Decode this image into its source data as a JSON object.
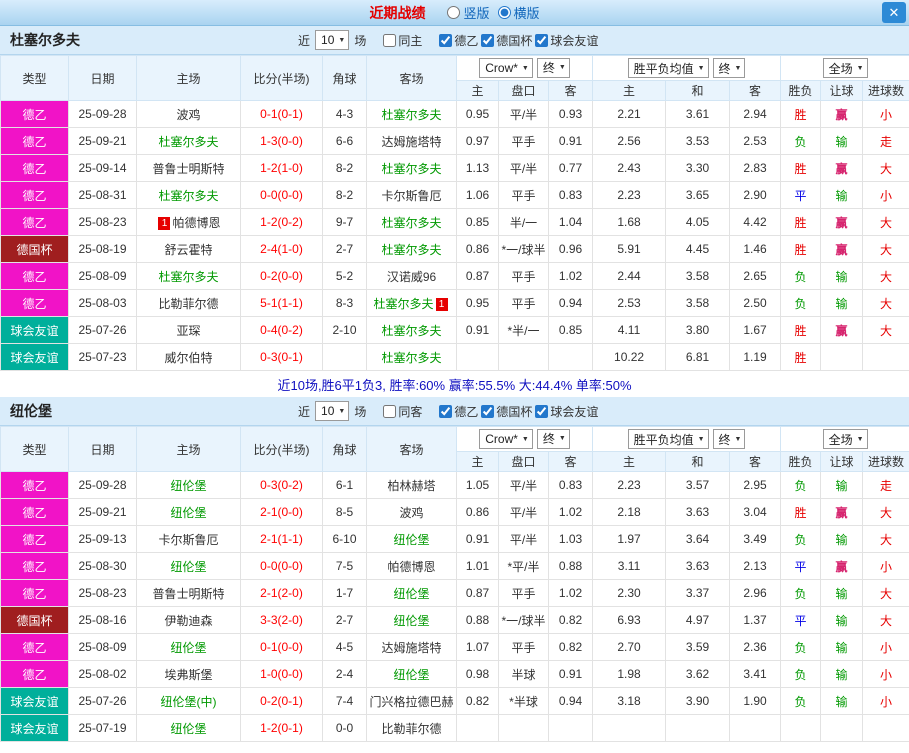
{
  "titlebar": {
    "title": "近期战绩",
    "layout_options": [
      "竖版",
      "横版"
    ],
    "selected_layout": "横版",
    "close_icon": "✕"
  },
  "columns": {
    "type": "类型",
    "date": "日期",
    "home": "主场",
    "score": "比分(半场)",
    "corner": "角球",
    "away": "客场",
    "ah_home": "主",
    "ah_line": "盘口",
    "ah_away": "客",
    "eu_home": "主",
    "eu_draw": "和",
    "eu_away": "客",
    "result": "胜负",
    "let_ball": "让球",
    "goals": "进球数"
  },
  "dropdowns": {
    "company": "Crow*",
    "final1": "终",
    "avg": "胜平负均值",
    "final2": "终",
    "scope": "全场"
  },
  "colors": {
    "league_de2": "#f113c7",
    "league_cup": "#a01e1f",
    "league_friendly": "#00af9b",
    "win": "#e60000",
    "draw": "#0000e6",
    "loss": "#009900",
    "focus_team": "#009900",
    "score": "#ff0000",
    "handicap_win": "#d6246e"
  },
  "sections": [
    {
      "team": "杜塞尔多夫",
      "filters": {
        "near": "近",
        "count": "10",
        "games": "场",
        "same": {
          "label": "同主",
          "checked": false
        },
        "leagues": [
          {
            "label": "德乙",
            "checked": true
          },
          {
            "label": "德国杯",
            "checked": true
          },
          {
            "label": "球会友谊",
            "checked": true
          }
        ]
      },
      "rows": [
        {
          "league": "德乙",
          "league_class": "de2",
          "date": "25-09-28",
          "home": "波鸡",
          "home_focus": false,
          "home_badge": "",
          "score": "0-1(0-1)",
          "corner": "4-3",
          "away": "杜塞尔多夫",
          "away_focus": true,
          "away_badge": "",
          "asian_odds": [
            "0.95",
            "平/半",
            "0.93"
          ],
          "euro_odds": [
            "2.21",
            "3.61",
            "2.94"
          ],
          "result": "胜",
          "result_class": "win",
          "handicap_result": "赢",
          "handicap_class": "win",
          "goals": "小"
        },
        {
          "league": "德乙",
          "league_class": "de2",
          "date": "25-09-21",
          "home": "杜塞尔多夫",
          "home_focus": true,
          "home_badge": "",
          "score": "1-3(0-0)",
          "corner": "6-6",
          "away": "达姆施塔特",
          "away_focus": false,
          "away_badge": "",
          "asian_odds": [
            "0.97",
            "平手",
            "0.91"
          ],
          "euro_odds": [
            "2.56",
            "3.53",
            "2.53"
          ],
          "result": "负",
          "result_class": "loss",
          "handicap_result": "输",
          "handicap_class": "loss",
          "goals": "走"
        },
        {
          "league": "德乙",
          "league_class": "de2",
          "date": "25-09-14",
          "home": "普鲁士明斯特",
          "home_focus": false,
          "home_badge": "",
          "score": "1-2(1-0)",
          "corner": "8-2",
          "away": "杜塞尔多夫",
          "away_focus": true,
          "away_badge": "",
          "asian_odds": [
            "1.13",
            "平/半",
            "0.77"
          ],
          "euro_odds": [
            "2.43",
            "3.30",
            "2.83"
          ],
          "result": "胜",
          "result_class": "win",
          "handicap_result": "赢",
          "handicap_class": "win",
          "goals": "大"
        },
        {
          "league": "德乙",
          "league_class": "de2",
          "date": "25-08-31",
          "home": "杜塞尔多夫",
          "home_focus": true,
          "home_badge": "",
          "score": "0-0(0-0)",
          "corner": "8-2",
          "away": "卡尔斯鲁厄",
          "away_focus": false,
          "away_badge": "",
          "asian_odds": [
            "1.06",
            "平手",
            "0.83"
          ],
          "euro_odds": [
            "2.23",
            "3.65",
            "2.90"
          ],
          "result": "平",
          "result_class": "draw",
          "handicap_result": "输",
          "handicap_class": "loss",
          "goals": "小"
        },
        {
          "league": "德乙",
          "league_class": "de2",
          "date": "25-08-23",
          "home": "帕德博恩",
          "home_focus": false,
          "home_badge": "1",
          "score": "1-2(0-2)",
          "corner": "9-7",
          "away": "杜塞尔多夫",
          "away_focus": true,
          "away_badge": "",
          "asian_odds": [
            "0.85",
            "半/一",
            "1.04"
          ],
          "euro_odds": [
            "1.68",
            "4.05",
            "4.42"
          ],
          "result": "胜",
          "result_class": "win",
          "handicap_result": "赢",
          "handicap_class": "win",
          "goals": "大"
        },
        {
          "league": "德国杯",
          "league_class": "cup",
          "date": "25-08-19",
          "home": "舒云霍特",
          "home_focus": false,
          "home_badge": "",
          "score": "2-4(1-0)",
          "corner": "2-7",
          "away": "杜塞尔多夫",
          "away_focus": true,
          "away_badge": "",
          "asian_odds": [
            "0.86",
            "*一/球半",
            "0.96"
          ],
          "euro_odds": [
            "5.91",
            "4.45",
            "1.46"
          ],
          "result": "胜",
          "result_class": "win",
          "handicap_result": "赢",
          "handicap_class": "win",
          "goals": "大"
        },
        {
          "league": "德乙",
          "league_class": "de2",
          "date": "25-08-09",
          "home": "杜塞尔多夫",
          "home_focus": true,
          "home_badge": "",
          "score": "0-2(0-0)",
          "corner": "5-2",
          "away": "汉诺威96",
          "away_focus": false,
          "away_badge": "",
          "asian_odds": [
            "0.87",
            "平手",
            "1.02"
          ],
          "euro_odds": [
            "2.44",
            "3.58",
            "2.65"
          ],
          "result": "负",
          "result_class": "loss",
          "handicap_result": "输",
          "handicap_class": "loss",
          "goals": "大"
        },
        {
          "league": "德乙",
          "league_class": "de2",
          "date": "25-08-03",
          "home": "比勒菲尔德",
          "home_focus": false,
          "home_badge": "",
          "score": "5-1(1-1)",
          "corner": "8-3",
          "away": "杜塞尔多夫",
          "away_focus": true,
          "away_badge": "1",
          "asian_odds": [
            "0.95",
            "平手",
            "0.94"
          ],
          "euro_odds": [
            "2.53",
            "3.58",
            "2.50"
          ],
          "result": "负",
          "result_class": "loss",
          "handicap_result": "输",
          "handicap_class": "loss",
          "goals": "大"
        },
        {
          "league": "球会友谊",
          "league_class": "friendly",
          "date": "25-07-26",
          "home": "亚琛",
          "home_focus": false,
          "home_badge": "",
          "score": "0-4(0-2)",
          "corner": "2-10",
          "away": "杜塞尔多夫",
          "away_focus": true,
          "away_badge": "",
          "asian_odds": [
            "0.91",
            "*半/一",
            "0.85"
          ],
          "euro_odds": [
            "4.11",
            "3.80",
            "1.67"
          ],
          "result": "胜",
          "result_class": "win",
          "handicap_result": "赢",
          "handicap_class": "win",
          "goals": "大"
        },
        {
          "league": "球会友谊",
          "league_class": "friendly",
          "date": "25-07-23",
          "home": "威尔伯特",
          "home_focus": false,
          "home_badge": "",
          "score": "0-3(0-1)",
          "corner": "",
          "away": "杜塞尔多夫",
          "away_focus": true,
          "away_badge": "",
          "asian_odds": [
            "",
            "",
            ""
          ],
          "euro_odds": [
            "10.22",
            "6.81",
            "1.19"
          ],
          "result": "胜",
          "result_class": "win",
          "handicap_result": "",
          "handicap_class": "",
          "goals": ""
        }
      ],
      "summary": "近10场,胜6平1负3, 胜率:60% 赢率:55.5% 大:44.4% 单率:50%"
    },
    {
      "team": "纽伦堡",
      "filters": {
        "near": "近",
        "count": "10",
        "games": "场",
        "same": {
          "label": "同客",
          "checked": false
        },
        "leagues": [
          {
            "label": "德乙",
            "checked": true
          },
          {
            "label": "德国杯",
            "checked": true
          },
          {
            "label": "球会友谊",
            "checked": true
          }
        ]
      },
      "rows": [
        {
          "league": "德乙",
          "league_class": "de2",
          "date": "25-09-28",
          "home": "纽伦堡",
          "home_focus": true,
          "home_badge": "",
          "score": "0-3(0-2)",
          "corner": "6-1",
          "away": "柏林赫塔",
          "away_focus": false,
          "away_badge": "",
          "asian_odds": [
            "1.05",
            "平/半",
            "0.83"
          ],
          "euro_odds": [
            "2.23",
            "3.57",
            "2.95"
          ],
          "result": "负",
          "result_class": "loss",
          "handicap_result": "输",
          "handicap_class": "loss",
          "goals": "走"
        },
        {
          "league": "德乙",
          "league_class": "de2",
          "date": "25-09-21",
          "home": "纽伦堡",
          "home_focus": true,
          "home_badge": "",
          "score": "2-1(0-0)",
          "corner": "8-5",
          "away": "波鸡",
          "away_focus": false,
          "away_badge": "",
          "asian_odds": [
            "0.86",
            "平/半",
            "1.02"
          ],
          "euro_odds": [
            "2.18",
            "3.63",
            "3.04"
          ],
          "result": "胜",
          "result_class": "win",
          "handicap_result": "赢",
          "handicap_class": "win",
          "goals": "大"
        },
        {
          "league": "德乙",
          "league_class": "de2",
          "date": "25-09-13",
          "home": "卡尔斯鲁厄",
          "home_focus": false,
          "home_badge": "",
          "score": "2-1(1-1)",
          "corner": "6-10",
          "away": "纽伦堡",
          "away_focus": true,
          "away_badge": "",
          "asian_odds": [
            "0.91",
            "平/半",
            "1.03"
          ],
          "euro_odds": [
            "1.97",
            "3.64",
            "3.49"
          ],
          "result": "负",
          "result_class": "loss",
          "handicap_result": "输",
          "handicap_class": "loss",
          "goals": "大"
        },
        {
          "league": "德乙",
          "league_class": "de2",
          "date": "25-08-30",
          "home": "纽伦堡",
          "home_focus": true,
          "home_badge": "",
          "score": "0-0(0-0)",
          "corner": "7-5",
          "away": "帕德博恩",
          "away_focus": false,
          "away_badge": "",
          "asian_odds": [
            "1.01",
            "*平/半",
            "0.88"
          ],
          "euro_odds": [
            "3.11",
            "3.63",
            "2.13"
          ],
          "result": "平",
          "result_class": "draw",
          "handicap_result": "赢",
          "handicap_class": "win",
          "goals": "小"
        },
        {
          "league": "德乙",
          "league_class": "de2",
          "date": "25-08-23",
          "home": "普鲁士明斯特",
          "home_focus": false,
          "home_badge": "",
          "score": "2-1(2-0)",
          "corner": "1-7",
          "away": "纽伦堡",
          "away_focus": true,
          "away_badge": "",
          "asian_odds": [
            "0.87",
            "平手",
            "1.02"
          ],
          "euro_odds": [
            "2.30",
            "3.37",
            "2.96"
          ],
          "result": "负",
          "result_class": "loss",
          "handicap_result": "输",
          "handicap_class": "loss",
          "goals": "大"
        },
        {
          "league": "德国杯",
          "league_class": "cup",
          "date": "25-08-16",
          "home": "伊勒迪森",
          "home_focus": false,
          "home_badge": "",
          "score": "3-3(2-0)",
          "corner": "2-7",
          "away": "纽伦堡",
          "away_focus": true,
          "away_badge": "",
          "asian_odds": [
            "0.88",
            "*一/球半",
            "0.82"
          ],
          "euro_odds": [
            "6.93",
            "4.97",
            "1.37"
          ],
          "result": "平",
          "result_class": "draw",
          "handicap_result": "输",
          "handicap_class": "loss",
          "goals": "大"
        },
        {
          "league": "德乙",
          "league_class": "de2",
          "date": "25-08-09",
          "home": "纽伦堡",
          "home_focus": true,
          "home_badge": "",
          "score": "0-1(0-0)",
          "corner": "4-5",
          "away": "达姆施塔特",
          "away_focus": false,
          "away_badge": "",
          "asian_odds": [
            "1.07",
            "平手",
            "0.82"
          ],
          "euro_odds": [
            "2.70",
            "3.59",
            "2.36"
          ],
          "result": "负",
          "result_class": "loss",
          "handicap_result": "输",
          "handicap_class": "loss",
          "goals": "小"
        },
        {
          "league": "德乙",
          "league_class": "de2",
          "date": "25-08-02",
          "home": "埃弗斯堡",
          "home_focus": false,
          "home_badge": "",
          "score": "1-0(0-0)",
          "corner": "2-4",
          "away": "纽伦堡",
          "away_focus": true,
          "away_badge": "",
          "asian_odds": [
            "0.98",
            "半球",
            "0.91"
          ],
          "euro_odds": [
            "1.98",
            "3.62",
            "3.41"
          ],
          "result": "负",
          "result_class": "loss",
          "handicap_result": "输",
          "handicap_class": "loss",
          "goals": "小"
        },
        {
          "league": "球会友谊",
          "league_class": "friendly",
          "date": "25-07-26",
          "home": "纽伦堡(中)",
          "home_focus": true,
          "home_badge": "",
          "score": "0-2(0-1)",
          "corner": "7-4",
          "away": "门兴格拉德巴赫",
          "away_focus": false,
          "away_badge": "",
          "asian_odds": [
            "0.82",
            "*半球",
            "0.94"
          ],
          "euro_odds": [
            "3.18",
            "3.90",
            "1.90"
          ],
          "result": "负",
          "result_class": "loss",
          "handicap_result": "输",
          "handicap_class": "loss",
          "goals": "小"
        },
        {
          "league": "球会友谊",
          "league_class": "friendly",
          "date": "25-07-19",
          "home": "纽伦堡",
          "home_focus": true,
          "home_badge": "",
          "score": "1-2(0-1)",
          "corner": "0-0",
          "away": "比勒菲尔德",
          "away_focus": false,
          "away_badge": "",
          "asian_odds": [
            "",
            "",
            ""
          ],
          "euro_odds": [
            "",
            "",
            ""
          ],
          "result": "",
          "result_class": "",
          "handicap_result": "",
          "handicap_class": "",
          "goals": ""
        }
      ],
      "summary": ""
    }
  ]
}
